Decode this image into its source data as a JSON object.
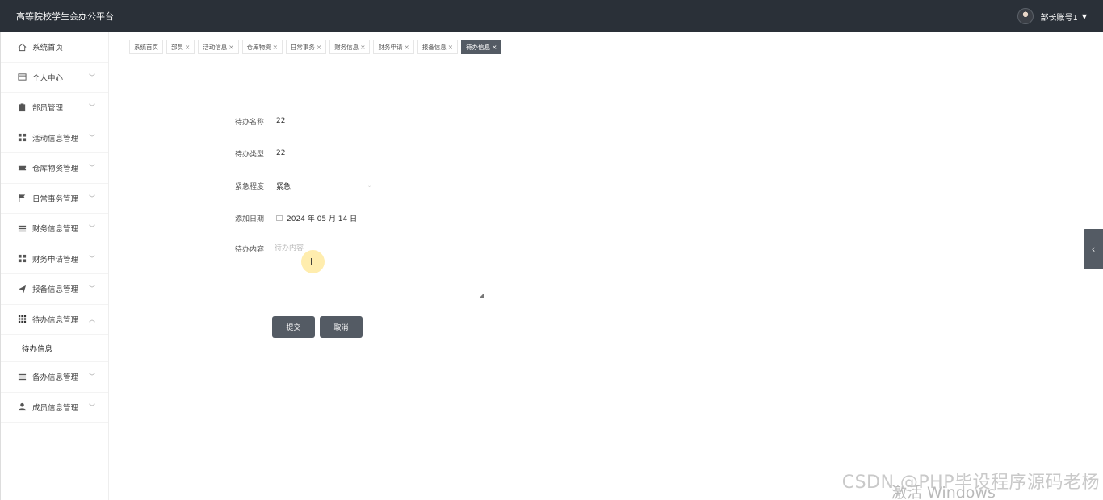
{
  "header": {
    "app_title": "高等院校学生会办公平台",
    "user_name": "部长账号1",
    "caret": "▼"
  },
  "sidebar": {
    "items": [
      {
        "label": "系统首页",
        "icon": "home-icon"
      },
      {
        "label": "个人中心",
        "icon": "profile-icon"
      },
      {
        "label": "部员管理",
        "icon": "clipboard-icon"
      },
      {
        "label": "活动信息管理",
        "icon": "grid-icon"
      },
      {
        "label": "仓库物资管理",
        "icon": "ticket-icon"
      },
      {
        "label": "日常事务管理",
        "icon": "flag-icon"
      },
      {
        "label": "财务信息管理",
        "icon": "list-icon"
      },
      {
        "label": "财务申请管理",
        "icon": "grid-icon"
      },
      {
        "label": "报备信息管理",
        "icon": "send-icon"
      },
      {
        "label": "待办信息管理",
        "icon": "apps-icon"
      },
      {
        "label": "备办信息管理",
        "icon": "list-icon"
      },
      {
        "label": "成员信息管理",
        "icon": "user-icon"
      }
    ],
    "submenu": [
      "待办信息"
    ]
  },
  "tabs": [
    {
      "label": "系统首页",
      "closable": false
    },
    {
      "label": "部员",
      "closable": true
    },
    {
      "label": "活动信息",
      "closable": true
    },
    {
      "label": "仓库物资",
      "closable": true
    },
    {
      "label": "日常事务",
      "closable": true
    },
    {
      "label": "财务信息",
      "closable": true
    },
    {
      "label": "财务申请",
      "closable": true
    },
    {
      "label": "报备信息",
      "closable": true
    },
    {
      "label": "待办信息",
      "closable": true,
      "active": true
    }
  ],
  "form": {
    "name_label": "待办名称",
    "name_value": "22",
    "type_label": "待办类型",
    "type_value": "22",
    "urgency_label": "紧急程度",
    "urgency_value": "紧急",
    "date_label": "添加日期",
    "date_value": "2024 年 05 月 14 日",
    "content_label": "待办内容",
    "content_placeholder": "待办内容"
  },
  "buttons": {
    "submit": "提交",
    "cancel": "取消"
  },
  "watermark": "CSDN @PHP毕设程序源码老杨",
  "activate_text": "激活 Windows",
  "colors": {
    "topbar": "#2a3038",
    "accent": "#545b64"
  }
}
